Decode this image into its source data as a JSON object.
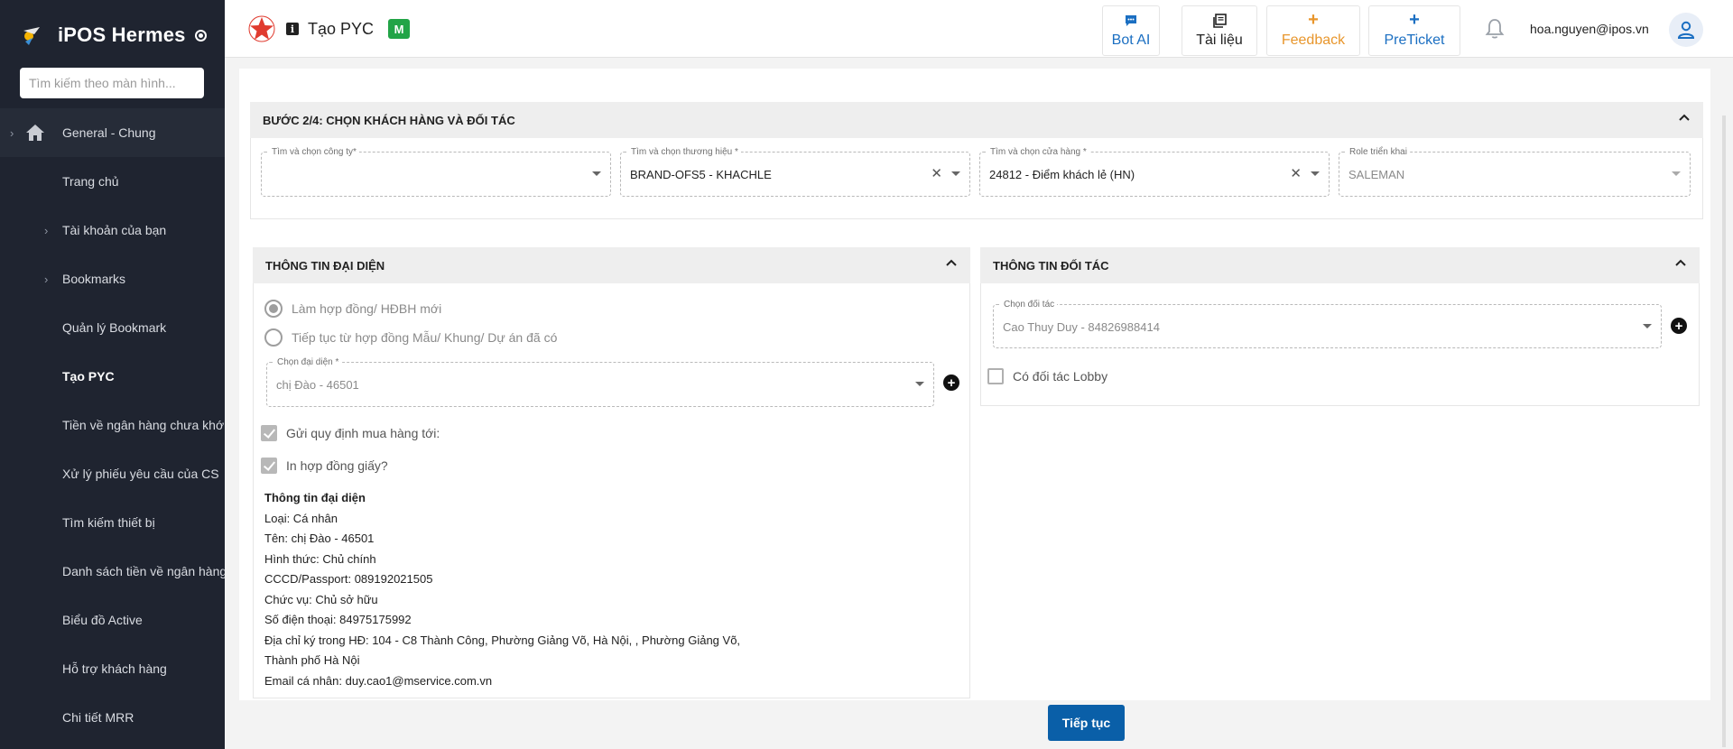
{
  "sidebar": {
    "brand": "iPOS Hermes",
    "search_placeholder": "Tìm kiếm theo màn hình...",
    "items": [
      {
        "label": "General - Chung",
        "icon": "home-icon",
        "expandable": true
      },
      {
        "label": "Trang chủ"
      },
      {
        "label": "Tài khoản của bạn",
        "expandable": true
      },
      {
        "label": "Bookmarks",
        "expandable": true
      },
      {
        "label": "Quản lý Bookmark"
      },
      {
        "label": "Tạo PYC",
        "active": true
      },
      {
        "label": "Tiền về ngân hàng chưa khớp"
      },
      {
        "label": "Xử lý phiếu yêu cầu của CS"
      },
      {
        "label": "Tìm kiếm thiết bị"
      },
      {
        "label": "Danh sách tiền về ngân hàng"
      },
      {
        "label": "Biểu đồ Active"
      },
      {
        "label": "Hỗ trợ khách hàng"
      },
      {
        "label": "Chi tiết MRR"
      }
    ]
  },
  "topbar": {
    "page_title": "Tạo PYC",
    "badge": "M",
    "buttons": {
      "bot_ai": "Bot AI",
      "tai_lieu": "Tài liệu",
      "feedback": "Feedback",
      "preticket": "PreTicket"
    },
    "user_email": "hoa.nguyen@ipos.vn"
  },
  "colors": {
    "sidebar_bg": "#1f2430",
    "primary": "#0a5fa8",
    "bot_ai": "#1b6fc2",
    "feedback": "#e8962c",
    "badge_green": "#22a447"
  },
  "step": {
    "title": "BƯỚC 2/4: CHỌN KHÁCH HÀNG VÀ ĐỐI TÁC",
    "fields": {
      "company": {
        "label": "Tìm và chọn công ty*",
        "value": ""
      },
      "brand": {
        "label": "Tìm và chọn thương hiệu *",
        "value": "BRAND-OFS5 - KHACHLE"
      },
      "store": {
        "label": "Tìm và chọn cửa hàng *",
        "value": "24812 - Điểm khách lẻ (HN)"
      },
      "role": {
        "label": "Role triển khai",
        "value": "SALEMAN"
      }
    }
  },
  "representative": {
    "title": "THÔNG TIN ĐẠI DIỆN",
    "radio_new": "Làm hợp đồng/ HĐBH mới",
    "radio_continue": "Tiếp tục từ hợp đồng Mẫu/ Khung/ Dự án đã có",
    "rep_field": {
      "label": "Chọn đại diện *",
      "value": "chị Đào - 46501"
    },
    "check_send": "Gửi quy định mua hàng tới:",
    "check_print": "In hợp đồng giấy?",
    "info": {
      "title": "Thông tin đại diện",
      "type": "Loại: Cá nhân",
      "name": "Tên: chị Đào - 46501",
      "form": "Hình thức: Chủ chính",
      "id": "CCCD/Passport: 089192021505",
      "position": "Chức vụ: Chủ sở hữu",
      "phone": "Số điện thoại: 84975175992",
      "address1": "Địa chỉ ký trong HĐ: 104 - C8 Thành Công, Phường Giảng Võ, Hà Nội, , Phường Giảng Võ,",
      "address2": "Thành phố Hà Nội",
      "email": "Email cá nhân: duy.cao1@mservice.com.vn"
    }
  },
  "partner": {
    "title": "THÔNG TIN ĐỐI TÁC",
    "partner_field": {
      "label": "Chọn đối tác",
      "value": "Cao Thuy Duy - 84826988414"
    },
    "check_lobby": "Có đối tác Lobby"
  },
  "continue_label": "Tiếp tục"
}
